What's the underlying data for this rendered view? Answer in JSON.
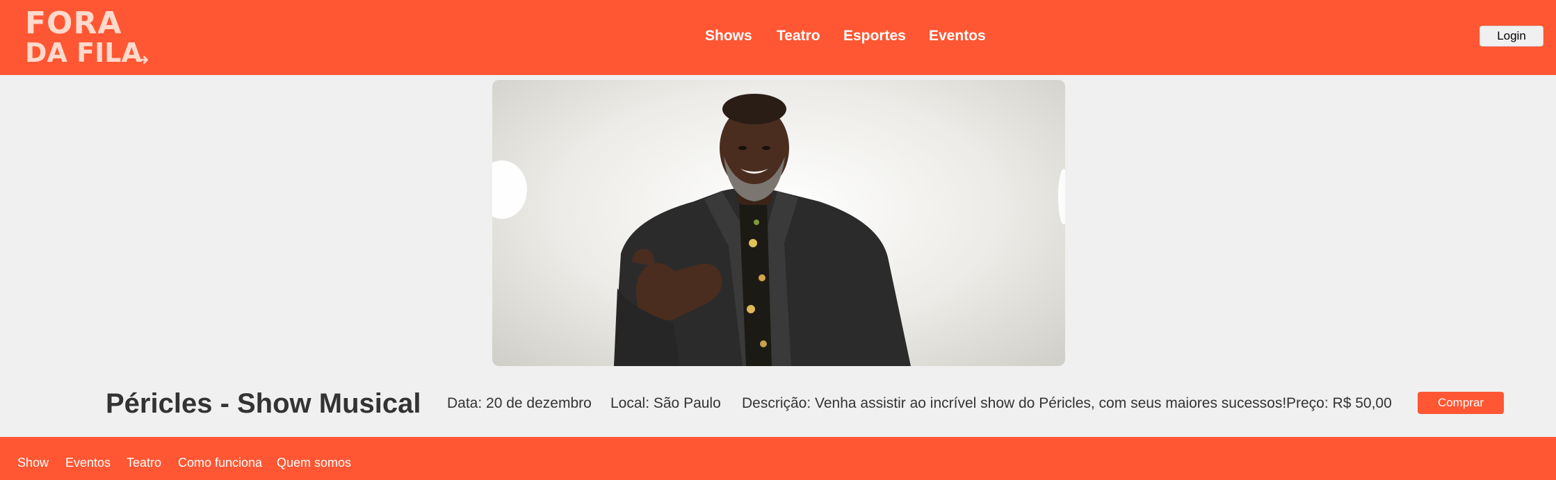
{
  "header": {
    "logo": {
      "line1": "FORA",
      "line2": "DA FILA",
      "arrow": "➜"
    },
    "nav": [
      {
        "label": "Shows"
      },
      {
        "label": "Teatro"
      },
      {
        "label": "Esportes"
      },
      {
        "label": "Eventos"
      }
    ],
    "login_label": "Login"
  },
  "event": {
    "title": "Péricles - Show Musical",
    "date": "Data: 20 de dezembro",
    "location": "Local: São Paulo",
    "description": "Descrição: Venha assistir ao incrível show do Péricles, com seus maiores sucessos!",
    "price": "Preço: R$ 50,00",
    "buy_label": "Comprar"
  },
  "footer": {
    "links": [
      {
        "label": "Show"
      },
      {
        "label": "Eventos"
      },
      {
        "label": "Teatro"
      },
      {
        "label": "Como funciona"
      },
      {
        "label": "Quem somos"
      }
    ]
  },
  "colors": {
    "brand": "#ff5733",
    "background": "#f0f0f0",
    "text": "#333333"
  }
}
